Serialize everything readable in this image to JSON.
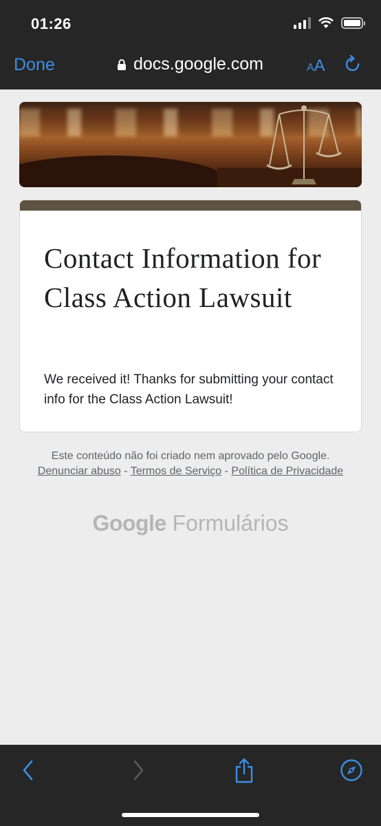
{
  "status": {
    "time": "01:26"
  },
  "nav": {
    "done_label": "Done",
    "url": "docs.google.com",
    "aa_small": "A",
    "aa_big": "A"
  },
  "form": {
    "title": "Contact Information for Class Action Lawsuit",
    "message": "We received it! Thanks for submitting your contact info for the Class Action Lawsuit!"
  },
  "footer": {
    "disclaimer": "Este conteúdo não foi criado nem aprovado pelo Google.",
    "report_link": "Denunciar abuso",
    "terms_link": "Termos de Serviço",
    "privacy_link": "Política de Privacidade",
    "separator": " - ",
    "brand_google": "Google",
    "brand_product": "Formulários"
  },
  "colors": {
    "accent": "#3b8ee6",
    "card_bar": "#5e5240",
    "chrome": "#262626"
  }
}
